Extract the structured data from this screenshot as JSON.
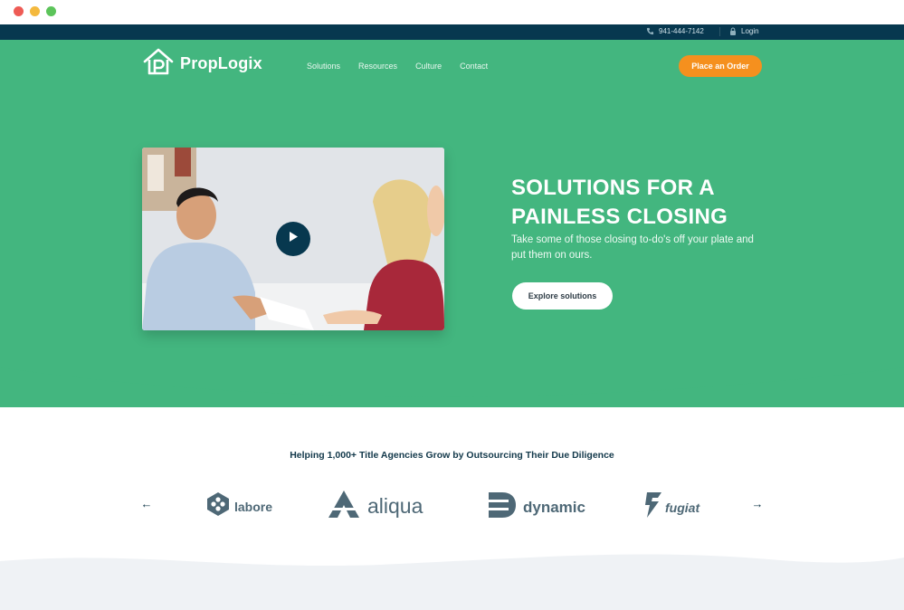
{
  "window": {
    "controls": [
      "close",
      "minimize",
      "maximize"
    ]
  },
  "topbar": {
    "phone": "941-444-7142",
    "phone_icon": "phone-icon",
    "login": "Login",
    "login_icon": "lock-icon"
  },
  "header": {
    "logo_text": "PropLogix",
    "logo_icon": "house-p-icon",
    "nav": [
      "Solutions",
      "Resources",
      "Culture",
      "Contact"
    ],
    "cta": "Place an Order"
  },
  "hero": {
    "headline_line1": "SOLUTIONS FOR A",
    "headline_line2": "PAINLESS CLOSING",
    "subtext": "Take some of those closing to-do's off your plate and put them on ours.",
    "button": "Explore solutions",
    "video_icon": "play-icon"
  },
  "partners": {
    "title": "Helping 1,000+ Title Agencies Grow by Outsourcing Their Due Diligence",
    "prev_icon": "arrow-left-icon",
    "next_icon": "arrow-right-icon",
    "prev": "←",
    "next": "→",
    "logos": [
      {
        "name": "labore",
        "icon": "hexagon-logo-icon"
      },
      {
        "name": "aliqua",
        "icon": "a-logo-icon"
      },
      {
        "name": "dynamic",
        "icon": "d-logo-icon"
      },
      {
        "name": "fugiat",
        "icon": "bolt-logo-icon"
      }
    ]
  },
  "colors": {
    "hero_green": "#43b67f",
    "topbar_navy": "#07384f",
    "cta_orange": "#f5901e",
    "partner_gray": "#4e6876"
  }
}
